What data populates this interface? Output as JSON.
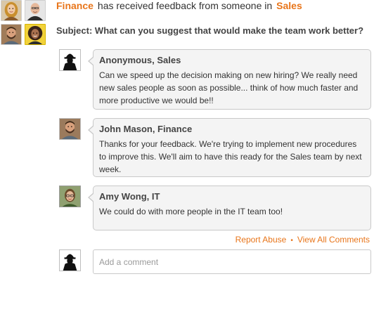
{
  "notification": {
    "from_dept": "Finance",
    "text": "has received feedback from someone in",
    "to_dept": "Sales",
    "colors": {
      "accent": "#e8751a"
    }
  },
  "subject": {
    "label": "Subject:",
    "text": "What can you suggest that would make the team work better?"
  },
  "participants": [
    {
      "icon": "woman-blonde-avatar"
    },
    {
      "icon": "man-bald-avatar"
    },
    {
      "icon": "man-beard-avatar"
    },
    {
      "icon": "woman-curly-hair-avatar"
    }
  ],
  "comments": [
    {
      "author": "Anonymous, Sales",
      "avatar": "anonymous-silhouette-avatar",
      "text": "Can we speed up the decision making on new hiring? We really need new sales people as soon as possible... think of how much faster and more productive we would be!!"
    },
    {
      "author": "John Mason, Finance",
      "avatar": "john-mason-avatar",
      "text": "Thanks for your feedback. We're trying to implement new procedures to improve this. We'll aim to have this ready for the Sales team by next week."
    },
    {
      "author": "Amy Wong, IT",
      "avatar": "amy-wong-avatar",
      "text": "We could do with more people in the IT team too!"
    }
  ],
  "actions": {
    "report_abuse": "Report Abuse",
    "separator": "•",
    "view_all": "View All Comments"
  },
  "add_comment": {
    "placeholder": "Add a comment",
    "avatar": "anonymous-silhouette-avatar"
  }
}
